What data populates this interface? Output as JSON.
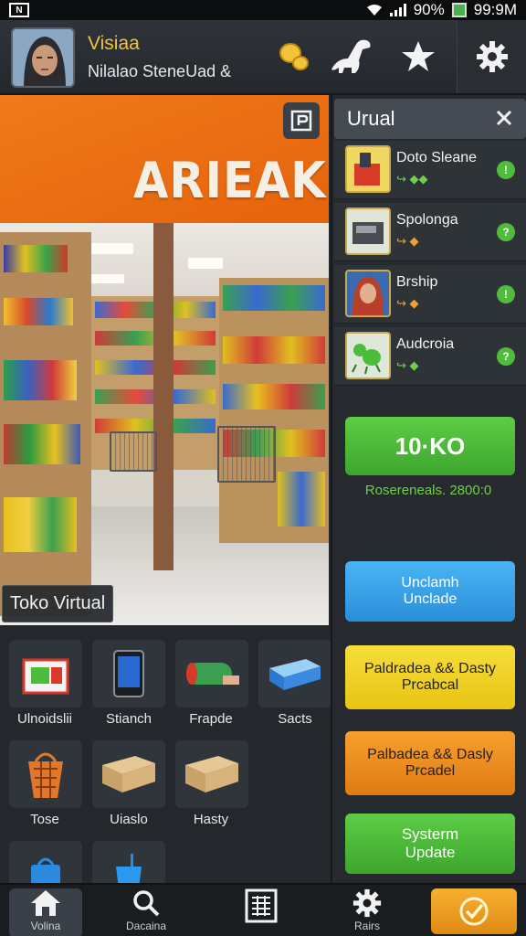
{
  "status": {
    "battery": "90%",
    "time": "99:9M"
  },
  "header": {
    "title": "Visiaa",
    "subtitle": "Nilalao SteneUad  &"
  },
  "store": {
    "banner_text": "ARIEAKIA",
    "label": "Toko Virtual"
  },
  "panel": {
    "title": "Urual",
    "items": [
      {
        "name": "Doto Sleane",
        "sub": "↪ ◆◆"
      },
      {
        "name": "Spolonga",
        "sub": "↪ ◆"
      },
      {
        "name": "Brship",
        "sub": "↪ ◆"
      },
      {
        "name": "Audcroia",
        "sub": "↪ ◆"
      }
    ],
    "counter_value": "10·KO",
    "counter_caption": "Rosereneals. 2800:0",
    "buttons": [
      {
        "line1": "Unclamh",
        "line2": "Unclade",
        "color": "#3aa3e8"
      },
      {
        "line1": "Paldradea && Dasty",
        "line2": "Prcabcal",
        "color": "#f2d21e"
      },
      {
        "line1": "Palbadea && Dasly",
        "line2": "Prcadel",
        "color": "#f08a1e"
      },
      {
        "line1": "Systerm",
        "line2": "Update",
        "color": "#4cbd3a"
      }
    ]
  },
  "grid": {
    "items": [
      {
        "label": "Ulnoidslii"
      },
      {
        "label": "Stianch"
      },
      {
        "label": "Frapde"
      },
      {
        "label": "Sacts"
      },
      {
        "label": "Tose"
      },
      {
        "label": "Uiaslo"
      },
      {
        "label": "Hasty"
      },
      {
        "label": ""
      },
      {
        "label": ""
      }
    ]
  },
  "nav": {
    "items": [
      {
        "label": "Volina"
      },
      {
        "label": "Dacaina"
      },
      {
        "label": ""
      },
      {
        "label": "Rairs"
      },
      {
        "label": ""
      }
    ]
  },
  "colors": {
    "accent_green": "#4fbd3a",
    "title_gold": "#f2c23a",
    "store_orange": "#f07a1a"
  }
}
